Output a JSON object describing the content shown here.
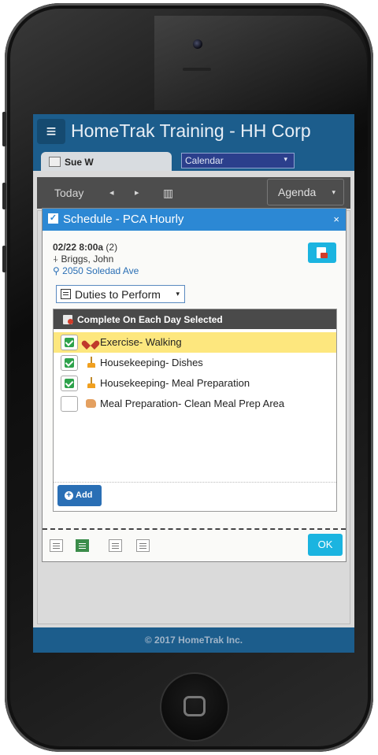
{
  "app": {
    "title": "HomeTrak Training - HH Corp",
    "menu_glyph": "≡",
    "user_tab": "Sue W",
    "calendar_select": "Calendar",
    "footer": "© 2017 HomeTrak Inc."
  },
  "toolbar": {
    "today": "Today",
    "prev": "◂",
    "next": "▸",
    "calendar_glyph": "▥",
    "view": "Agenda",
    "dropdown_glyph": "▾"
  },
  "dialog": {
    "title": "Schedule - PCA Hourly",
    "close": "×",
    "appt_date": "02/22 8:00a",
    "appt_count": "(2)",
    "client_glyph": "⍭",
    "client_name": "Briggs, John",
    "location_glyph": "⚲",
    "address": "2050 Soledad Ave",
    "duties_select": "Duties to Perform",
    "panel_header": "Complete On Each Day Selected",
    "duties": [
      {
        "label": "Exercise- Walking",
        "checked": true,
        "highlighted": true,
        "icon": "heart-icon"
      },
      {
        "label": "Housekeeping- Dishes",
        "checked": true,
        "highlighted": false,
        "icon": "broom-icon"
      },
      {
        "label": "Housekeeping- Meal Preparation",
        "checked": true,
        "highlighted": false,
        "icon": "broom-icon"
      },
      {
        "label": "Meal Preparation- Clean Meal Prep Area",
        "checked": false,
        "highlighted": false,
        "icon": "hand-icon"
      }
    ],
    "add_label": "Add",
    "add_glyph": "+",
    "ok_label": "OK"
  },
  "colors": {
    "header": "#1c5d8c",
    "dialog_title": "#2c88d4",
    "accent_button": "#1bb4e0",
    "highlight_row": "#fde77e",
    "check_green": "#2da24b"
  }
}
